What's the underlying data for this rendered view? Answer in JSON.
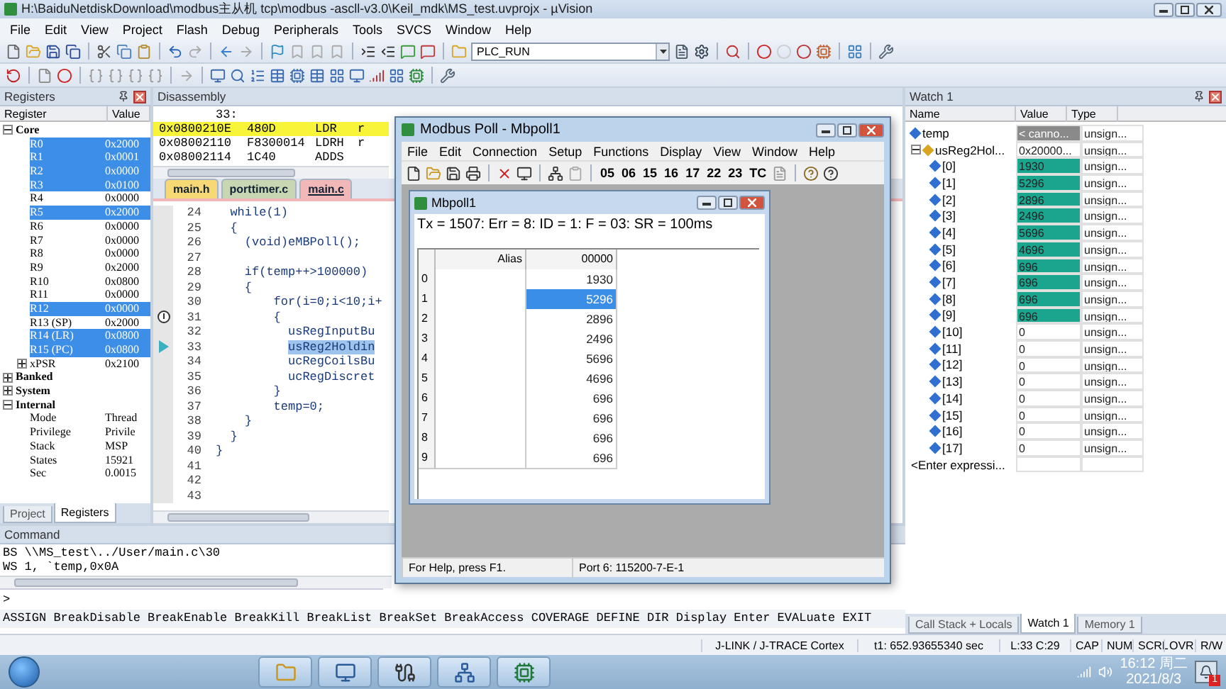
{
  "window": {
    "title": "H:\\BaiduNetdiskDownload\\modbus主从机 tcp\\modbus -ascll-v3.0\\Keil_mdk\\MS_test.uvprojx - µVision"
  },
  "menu": [
    "File",
    "Edit",
    "View",
    "Project",
    "Flash",
    "Debug",
    "Peripherals",
    "Tools",
    "SVCS",
    "Window",
    "Help"
  ],
  "toolbar": {
    "target": "PLC_RUN"
  },
  "registers": {
    "title": "Registers",
    "columns": [
      "Register",
      "Value"
    ],
    "tree": [
      {
        "label": "Core",
        "expanded": true,
        "children": [
          {
            "label": "R0",
            "value": "0x2000",
            "changed": true
          },
          {
            "label": "R1",
            "value": "0x0001",
            "changed": true
          },
          {
            "label": "R2",
            "value": "0x0000",
            "changed": true
          },
          {
            "label": "R3",
            "value": "0x0100",
            "changed": true
          },
          {
            "label": "R4",
            "value": "0x0000",
            "changed": false
          },
          {
            "label": "R5",
            "value": "0x2000",
            "changed": true
          },
          {
            "label": "R6",
            "value": "0x0000",
            "changed": false
          },
          {
            "label": "R7",
            "value": "0x0000",
            "changed": false
          },
          {
            "label": "R8",
            "value": "0x0000",
            "changed": false
          },
          {
            "label": "R9",
            "value": "0x2000",
            "changed": false
          },
          {
            "label": "R10",
            "value": "0x0800",
            "changed": false
          },
          {
            "label": "R11",
            "value": "0x0000",
            "changed": false
          },
          {
            "label": "R12",
            "value": "0x0000",
            "changed": true
          },
          {
            "label": "R13 (SP)",
            "value": "0x2000",
            "changed": false
          },
          {
            "label": "R14 (LR)",
            "value": "0x0800",
            "changed": true
          },
          {
            "label": "R15 (PC)",
            "value": "0x0800",
            "changed": true
          },
          {
            "label": "xPSR",
            "value": "0x2100",
            "changed": false,
            "expanded": false
          }
        ]
      },
      {
        "label": "Banked",
        "expanded": false
      },
      {
        "label": "System",
        "expanded": false
      },
      {
        "label": "Internal",
        "expanded": true,
        "children": [
          {
            "label": "Mode",
            "value": "Thread",
            "changed": false
          },
          {
            "label": "Privilege",
            "value": "Privile",
            "changed": false
          },
          {
            "label": "Stack",
            "value": "MSP",
            "changed": false
          },
          {
            "label": "States",
            "value": "15921",
            "changed": false
          },
          {
            "label": "Sec",
            "value": "0.0015",
            "changed": false
          }
        ]
      }
    ],
    "tabs": [
      {
        "label": "Project",
        "selected": false
      },
      {
        "label": "Registers",
        "selected": true
      }
    ]
  },
  "disassembly": {
    "title": "Disassembly",
    "lines": [
      {
        "kind": "source",
        "address": "33:",
        "current": false
      },
      {
        "kind": "instruction",
        "address": "0x0800210E",
        "opcode": "480D",
        "mnemonic": "LDR",
        "operand": "r",
        "current": true
      },
      {
        "kind": "instruction",
        "address": "0x08002110",
        "opcode": "F8300014",
        "mnemonic": "LDRH",
        "operand": "r",
        "current": false
      },
      {
        "kind": "instruction",
        "address": "0x08002114",
        "opcode": "1C40",
        "mnemonic": "ADDS",
        "current": false
      }
    ]
  },
  "editor": {
    "tabs": [
      {
        "label": "main.h",
        "selected": false,
        "color": "#f6d874"
      },
      {
        "label": "porttimer.c",
        "selected": false,
        "color": "#c9d6b4"
      },
      {
        "label": "main.c",
        "selected": true,
        "color": "#f2b8b8"
      }
    ],
    "lines": [
      {
        "number": "24",
        "text": "  while(1)",
        "breakpoint": false,
        "current": false,
        "selected": false
      },
      {
        "number": "25",
        "text": "  {",
        "breakpoint": false,
        "current": false,
        "selected": false
      },
      {
        "number": "26",
        "text": "    (void)eMBPoll();",
        "breakpoint": false,
        "current": false,
        "selected": false
      },
      {
        "number": "27",
        "breakpoint": false,
        "current": false,
        "selected": false
      },
      {
        "number": "28",
        "text": "    if(temp++>100000)",
        "breakpoint": false,
        "current": false,
        "selected": false
      },
      {
        "number": "29",
        "text": "    {",
        "breakpoint": false,
        "current": false,
        "selected": false
      },
      {
        "number": "30",
        "text": "        for(i=0;i<10;i+",
        "breakpoint": false,
        "current": false,
        "selected": false
      },
      {
        "number": "31",
        "text": "        {",
        "breakpoint": true,
        "current": false,
        "selected": false
      },
      {
        "number": "32",
        "text": "          usRegInputBu",
        "breakpoint": false,
        "current": false,
        "selected": false
      },
      {
        "number": "33",
        "text": "          usReg2Holdin",
        "breakpoint": false,
        "current": true,
        "selected": true
      },
      {
        "number": "34",
        "text": "          ucRegCoilsBu",
        "breakpoint": false,
        "current": false,
        "selected": false
      },
      {
        "number": "35",
        "text": "          ucRegDiscret",
        "breakpoint": false,
        "current": false,
        "selected": false
      },
      {
        "number": "36",
        "text": "        }",
        "breakpoint": false,
        "current": false,
        "selected": false
      },
      {
        "number": "37",
        "text": "        temp=0;",
        "breakpoint": false,
        "current": false,
        "selected": false
      },
      {
        "number": "38",
        "text": "    }",
        "breakpoint": false,
        "current": false,
        "selected": false
      },
      {
        "number": "39",
        "text": "  }",
        "breakpoint": false,
        "current": false,
        "selected": false
      },
      {
        "number": "40",
        "text": "}",
        "breakpoint": false,
        "current": false,
        "selected": false
      },
      {
        "number": "41",
        "breakpoint": false,
        "current": false,
        "selected": false
      },
      {
        "number": "42",
        "breakpoint": false,
        "current": false,
        "selected": false
      },
      {
        "number": "43",
        "breakpoint": false,
        "current": false,
        "selected": false
      }
    ]
  },
  "modbus": {
    "title": "Modbus Poll - Mbpoll1",
    "menu": [
      "File",
      "Edit",
      "Connection",
      "Setup",
      "Functions",
      "Display",
      "View",
      "Window",
      "Help"
    ],
    "function_codes": [
      "05",
      "06",
      "15",
      "16",
      "17",
      "22",
      "23",
      "TC"
    ],
    "child": {
      "title": "Mbpoll1",
      "status": "Tx = 1507: Err = 8: ID = 1: F = 03: SR = 100ms",
      "columns": [
        "Alias",
        "00000"
      ],
      "rows": [
        {
          "index": "0",
          "value": "1930",
          "selected": false
        },
        {
          "index": "1",
          "value": "5296",
          "selected": true
        },
        {
          "index": "2",
          "value": "2896",
          "selected": false
        },
        {
          "index": "3",
          "value": "2496",
          "selected": false
        },
        {
          "index": "4",
          "value": "5696",
          "selected": false
        },
        {
          "index": "5",
          "value": "4696",
          "selected": false
        },
        {
          "index": "6",
          "value": "696",
          "selected": false
        },
        {
          "index": "7",
          "value": "696",
          "selected": false
        },
        {
          "index": "8",
          "value": "696",
          "selected": false
        },
        {
          "index": "9",
          "value": "696",
          "selected": false
        }
      ]
    },
    "status_bar": [
      "For Help, press F1.",
      "Port 6: 115200-7-E-1"
    ]
  },
  "watch": {
    "title": "Watch 1",
    "columns": [
      "Name",
      "Value",
      "Type"
    ],
    "rows": [
      {
        "kind": "variable",
        "name": "temp",
        "value": "< canno...",
        "type": "unsign...",
        "changed": false,
        "unavailable": true
      },
      {
        "kind": "array",
        "name": "usReg2Hol...",
        "value": "0x20000...",
        "type": "unsign...",
        "changed": false,
        "unavailable": false,
        "expanded": true,
        "children": [
          {
            "kind": "variable",
            "name": "[0]",
            "value": "1930",
            "type": "unsign...",
            "changed": true,
            "unavailable": false
          },
          {
            "kind": "variable",
            "name": "[1]",
            "value": "5296",
            "type": "unsign...",
            "changed": true,
            "unavailable": false
          },
          {
            "kind": "variable",
            "name": "[2]",
            "value": "2896",
            "type": "unsign...",
            "changed": true,
            "unavailable": false
          },
          {
            "kind": "variable",
            "name": "[3]",
            "value": "2496",
            "type": "unsign...",
            "changed": true,
            "unavailable": false
          },
          {
            "kind": "variable",
            "name": "[4]",
            "value": "5696",
            "type": "unsign...",
            "changed": true,
            "unavailable": false
          },
          {
            "kind": "variable",
            "name": "[5]",
            "value": "4696",
            "type": "unsign...",
            "changed": true,
            "unavailable": false
          },
          {
            "kind": "variable",
            "name": "[6]",
            "value": "696",
            "type": "unsign...",
            "changed": true,
            "unavailable": false
          },
          {
            "kind": "variable",
            "name": "[7]",
            "value": "696",
            "type": "unsign...",
            "changed": true,
            "unavailable": false
          },
          {
            "kind": "variable",
            "name": "[8]",
            "value": "696",
            "type": "unsign...",
            "changed": true,
            "unavailable": false
          },
          {
            "kind": "variable",
            "name": "[9]",
            "value": "696",
            "type": "unsign...",
            "changed": true,
            "unavailable": false
          },
          {
            "kind": "variable",
            "name": "[10]",
            "value": "0",
            "type": "unsign...",
            "changed": false,
            "unavailable": false
          },
          {
            "kind": "variable",
            "name": "[11]",
            "value": "0",
            "type": "unsign...",
            "changed": false,
            "unavailable": false
          },
          {
            "kind": "variable",
            "name": "[12]",
            "value": "0",
            "type": "unsign...",
            "changed": false,
            "unavailable": false
          },
          {
            "kind": "variable",
            "name": "[13]",
            "value": "0",
            "type": "unsign...",
            "changed": false,
            "unavailable": false
          },
          {
            "kind": "variable",
            "name": "[14]",
            "value": "0",
            "type": "unsign...",
            "changed": false,
            "unavailable": false
          },
          {
            "kind": "variable",
            "name": "[15]",
            "value": "0",
            "type": "unsign...",
            "changed": false,
            "unavailable": false
          },
          {
            "kind": "variable",
            "name": "[16]",
            "value": "0",
            "type": "unsign...",
            "changed": false,
            "unavailable": false
          },
          {
            "kind": "variable",
            "name": "[17]",
            "value": "0",
            "type": "unsign...",
            "changed": false,
            "unavailable": false
          }
        ]
      },
      {
        "kind": "prompt",
        "name": "<Enter expressi..."
      }
    ],
    "tabs": [
      {
        "label": "Call Stack + Locals",
        "selected": false
      },
      {
        "label": "Watch 1",
        "selected": true
      },
      {
        "label": "Memory 1",
        "selected": false
      }
    ]
  },
  "command": {
    "title": "Command",
    "output": [
      "BS \\\\MS_test\\../User/main.c\\30",
      "WS 1, `temp,0x0A"
    ],
    "prompt": ">",
    "help": "ASSIGN BreakDisable BreakEnable BreakKill BreakList BreakSet BreakAccess COVERAGE DEFINE DIR Display Enter EVALuate EXIT"
  },
  "status_bar": {
    "debugger": "J-LINK / J-TRACE Cortex",
    "time": "t1: 652.93655340 sec",
    "position": "L:33 C:29",
    "indicators": [
      "CAP",
      "NUM",
      "SCRL",
      "OVR",
      "R/W"
    ]
  },
  "taskbar": {
    "time": "16:12 周二",
    "date": "2021/8/3",
    "notification_count": "1"
  }
}
